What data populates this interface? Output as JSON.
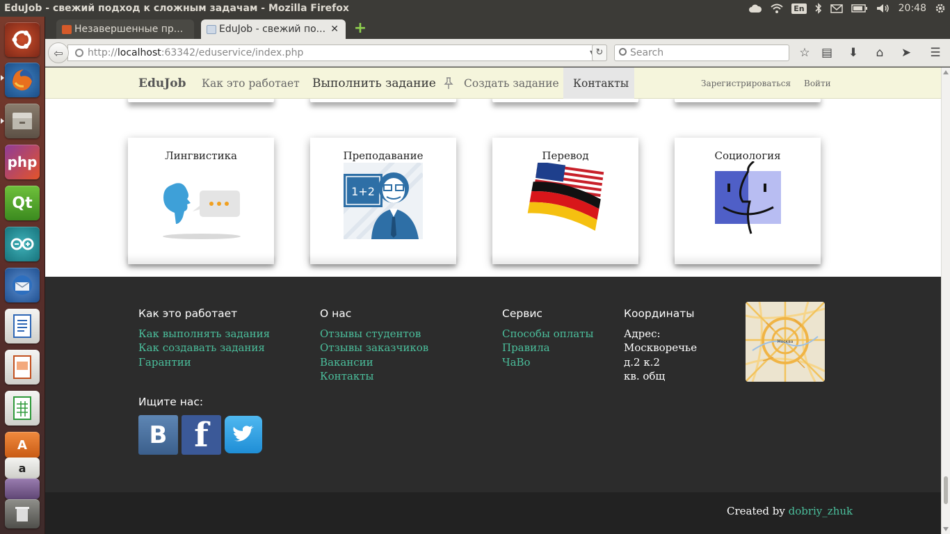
{
  "os": {
    "window_title": "EduJob - свежий подход к сложным задачам - Mozilla Firefox",
    "keyboard_layout": "En",
    "clock": "20:48",
    "launcher_apps": [
      "ubuntu-dash",
      "firefox",
      "files",
      "phpstorm",
      "qt-creator",
      "arduino",
      "thunderbird",
      "libreoffice-writer",
      "libreoffice-impress",
      "libreoffice-calc",
      "software-center",
      "amazon",
      "unknown-app",
      "trash"
    ]
  },
  "browser": {
    "tabs": [
      {
        "title": "Незавершенные пр...",
        "active": false
      },
      {
        "title": "EduJob - свежий по...",
        "active": true
      }
    ],
    "url_prefix": "http://",
    "url_host": "localhost",
    "url_rest": ":63342/eduservice/index.php",
    "search_placeholder": "Search"
  },
  "site": {
    "brand": "EduJob",
    "nav": {
      "how": "Как это работает",
      "do_task": "Выполнить задание",
      "create_task": "Создать задание",
      "contacts": "Контакты",
      "register": "Зарегистрироваться",
      "login": "Войти"
    },
    "categories": [
      {
        "title": "Лингвистика",
        "icon": "speech-bubble-icon"
      },
      {
        "title": "Преподавание",
        "icon": "teacher-icon"
      },
      {
        "title": "Перевод",
        "icon": "flags-icon"
      },
      {
        "title": "Социология",
        "icon": "finder-face-icon"
      }
    ],
    "footer": {
      "col_how": {
        "heading": "Как это работает",
        "links": [
          "Как выполнять задания",
          "Как создавать задания",
          "Гарантии"
        ]
      },
      "col_about": {
        "heading": "О нас",
        "links": [
          "Отзывы студентов",
          "Отзывы заказчиков",
          "Вакансии",
          "Контакты"
        ]
      },
      "col_service": {
        "heading": "Сервис",
        "links": [
          "Способы оплаты",
          "Правила",
          "ЧаВо"
        ]
      },
      "col_coords": {
        "heading": "Координаты",
        "lines": [
          "Адрес:",
          "Москворечье",
          "д.2 к.2",
          "кв. общ"
        ]
      },
      "map_label": "Москва",
      "find_us": "Ищите нас:",
      "social": [
        "vk",
        "facebook",
        "twitter"
      ],
      "created_by": "Created by",
      "author": "dobriy_zhuk"
    }
  }
}
